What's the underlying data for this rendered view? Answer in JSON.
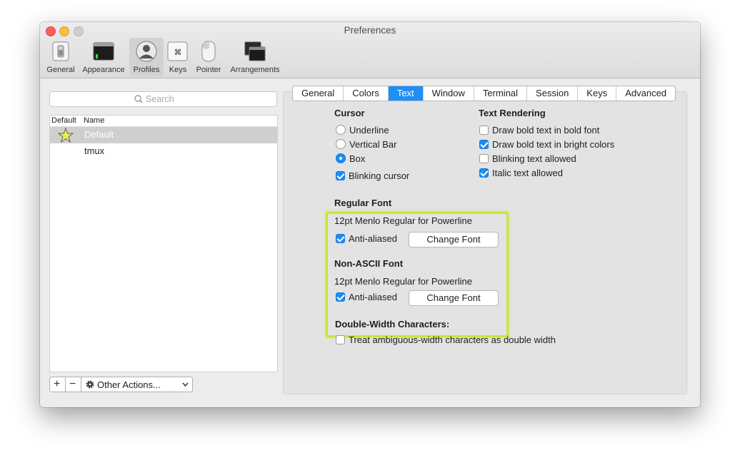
{
  "window": {
    "title": "Preferences"
  },
  "toolbar": {
    "items": [
      {
        "label": "General",
        "icon": "switch-icon"
      },
      {
        "label": "Appearance",
        "icon": "window-icon"
      },
      {
        "label": "Profiles",
        "icon": "person-icon",
        "selected": true
      },
      {
        "label": "Keys",
        "icon": "command-key-icon"
      },
      {
        "label": "Pointer",
        "icon": "mouse-icon"
      },
      {
        "label": "Arrangements",
        "icon": "windows-icon"
      }
    ]
  },
  "profiles": {
    "search_placeholder": "Search",
    "columns": [
      "Default",
      "Name"
    ],
    "rows": [
      {
        "name": "Default",
        "is_default": true,
        "selected": true
      },
      {
        "name": "tmux",
        "is_default": false,
        "selected": false
      }
    ],
    "add_label": "+",
    "remove_label": "−",
    "other_actions_label": "Other Actions..."
  },
  "tabs": {
    "items": [
      "General",
      "Colors",
      "Text",
      "Window",
      "Terminal",
      "Session",
      "Keys",
      "Advanced"
    ],
    "active": "Text"
  },
  "cursor": {
    "title": "Cursor",
    "options": [
      "Underline",
      "Vertical Bar",
      "Box"
    ],
    "selected": "Box",
    "blinking_label": "Blinking cursor",
    "blinking": true
  },
  "text_rendering": {
    "title": "Text Rendering",
    "items": [
      {
        "label": "Draw bold text in bold font",
        "checked": false
      },
      {
        "label": "Draw bold text in bright colors",
        "checked": true
      },
      {
        "label": "Blinking text allowed",
        "checked": false
      },
      {
        "label": "Italic text allowed",
        "checked": true
      }
    ]
  },
  "regular_font": {
    "title": "Regular Font",
    "description": "12pt Menlo Regular for Powerline",
    "anti_aliased_label": "Anti-aliased",
    "anti_aliased": true,
    "change_font_label": "Change Font"
  },
  "non_ascii_font": {
    "title": "Non-ASCII Font",
    "description": "12pt Menlo Regular for Powerline",
    "anti_aliased_label": "Anti-aliased",
    "anti_aliased": true,
    "change_font_label": "Change Font"
  },
  "double_width": {
    "title": "Double-Width Characters:",
    "option_label": "Treat ambiguous-width characters as double width",
    "checked": false
  },
  "colors": {
    "accent": "#1d8cf4",
    "highlight": "#c7e63a",
    "close": "#fc605c",
    "minimize": "#fdbc40",
    "zoom": "#cfcfcf"
  }
}
